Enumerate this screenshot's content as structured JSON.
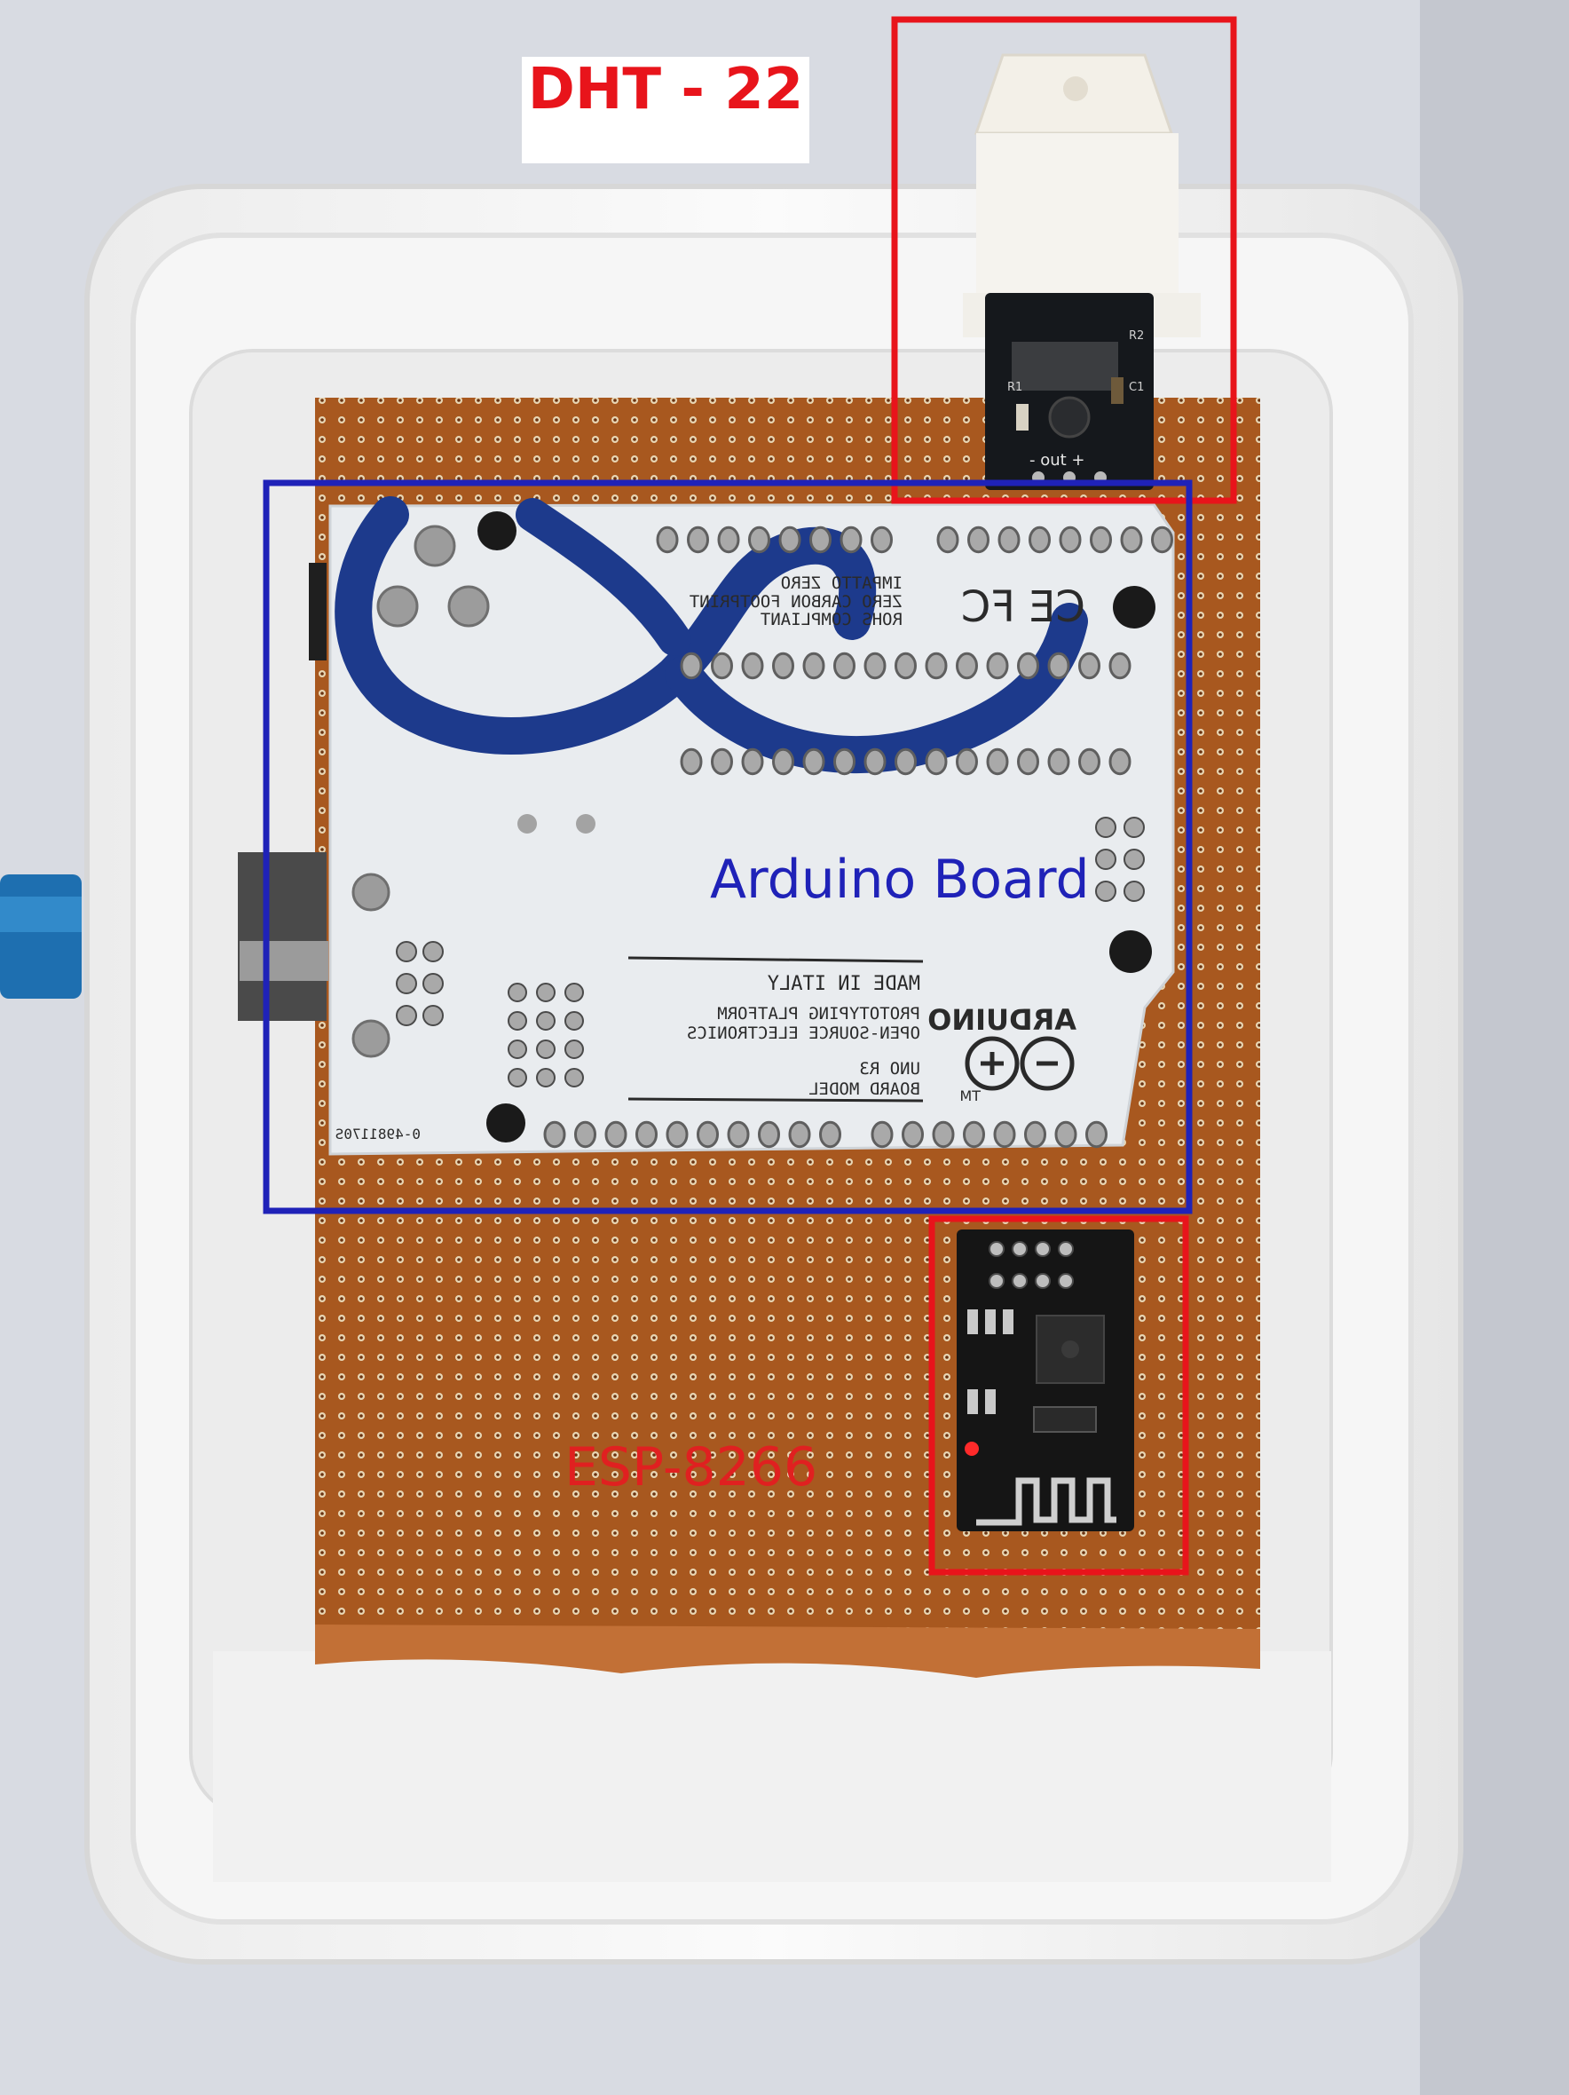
{
  "annotations": {
    "dht": {
      "label": "DHT - 22",
      "color": "#e8141b"
    },
    "arduino": {
      "label": "Arduino Board",
      "color": "#1f22b8"
    },
    "esp": {
      "label": "ESP-8266",
      "color": "#e02020"
    }
  },
  "board_silkscreen": {
    "compliance": [
      "ROHS COMPLIANT",
      "ZERO CARBON FOOTPRINT",
      "IMPATTO ZERO"
    ],
    "made_in": "MADE IN ITALY",
    "platform": [
      "OPEN-SOURCE ELECTRONICS",
      "PROTOTYPING PLATFORM"
    ],
    "model": [
      "BOARD MODEL",
      "UNO R3"
    ],
    "brand": "ARDUINO",
    "tm": "TM",
    "fcc": "FC",
    "ce": "CE",
    "serial": "0-4981170S"
  },
  "sensor_silkscreen": {
    "pins": "- out +",
    "r1": "R1",
    "r2": "R2",
    "c1": "C1"
  },
  "colors": {
    "background": "#d8dbe2",
    "enclosure": "#f4f4f4",
    "perfboard": "#a8581f",
    "arduino_pcb": "#e9ecef",
    "arduino_blue": "#1d3a8c",
    "esp_pcb": "#151515"
  }
}
